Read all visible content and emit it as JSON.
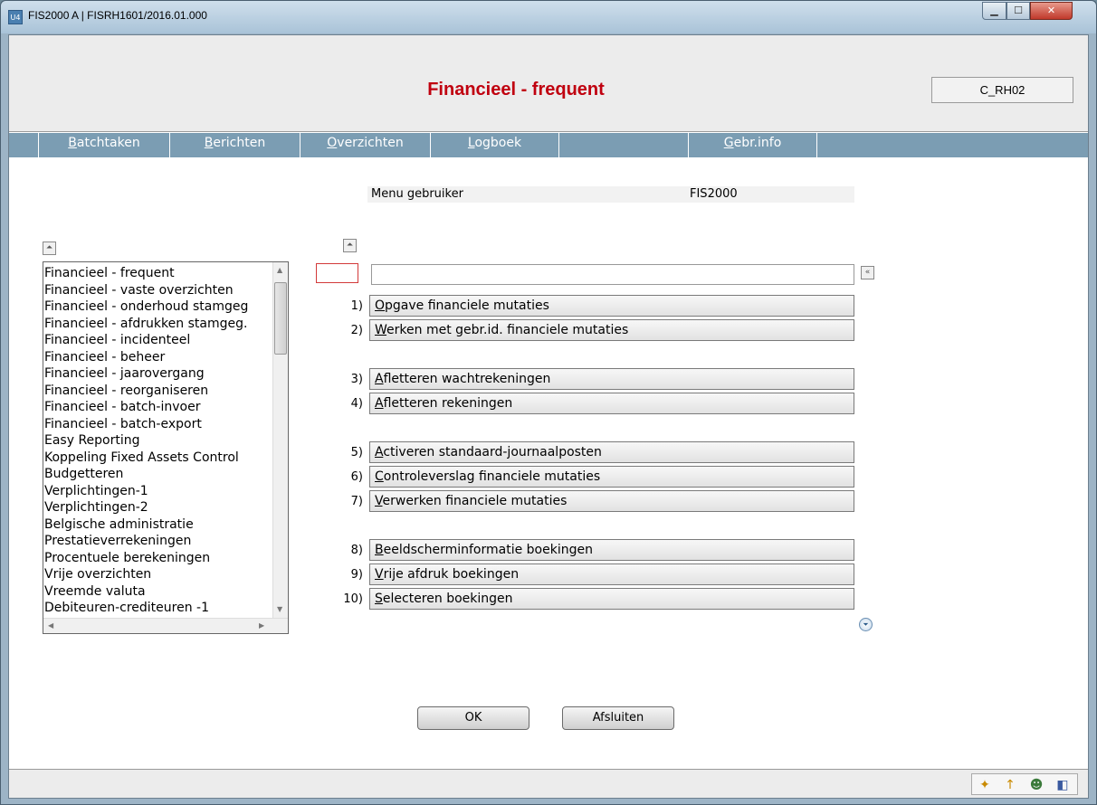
{
  "window": {
    "title": "FIS2000 A | FISRH1601/2016.01.000",
    "app_icon": "U4",
    "controls": {
      "minimize": "▁",
      "maximize": "☐",
      "close": "✕"
    }
  },
  "header": {
    "title": "Financieel - frequent",
    "screen_code": "C_RH02"
  },
  "menubar": {
    "items": [
      {
        "key": "B",
        "rest": "atchtaken"
      },
      {
        "key": "B",
        "rest": "erichten"
      },
      {
        "key": "O",
        "rest": "verzichten"
      },
      {
        "key": "L",
        "rest": "ogboek"
      },
      {
        "key": "",
        "rest": ""
      },
      {
        "key": "G",
        "rest": "ebr.info"
      }
    ]
  },
  "menu_info": {
    "label": "Menu gebruiker",
    "value": "FIS2000"
  },
  "menu_list": {
    "items": [
      "Financieel - frequent",
      "Financieel - vaste overzichten",
      "Financieel - onderhoud stamgeg",
      "Financieel - afdrukken stamgeg.",
      "Financieel - incidenteel",
      "Financieel - beheer",
      "Financieel - jaarovergang",
      "Financieel - reorganiseren",
      "Financieel - batch-invoer",
      "Financieel - batch-export",
      "Easy Reporting",
      "Koppeling Fixed Assets Control",
      "Budgetteren",
      "Verplichtingen-1",
      "Verplichtingen-2",
      "Belgische administratie",
      "Prestatieverrekeningen",
      "Procentuele berekeningen",
      "Vrije overzichten",
      "Vreemde valuta",
      "Debiteuren-crediteuren -1"
    ]
  },
  "options": {
    "option_input": "",
    "search_input": "",
    "items": [
      {
        "num": "1)",
        "key": "O",
        "rest": "pgave financiele mutaties"
      },
      {
        "num": "2)",
        "key": "W",
        "rest": "erken met gebr.id. financiele mutaties"
      },
      {
        "num": "3)",
        "key": "A",
        "rest": "fletteren wachtrekeningen"
      },
      {
        "num": "4)",
        "key": "A",
        "rest": "fletteren rekeningen"
      },
      {
        "num": "5)",
        "key": "A",
        "rest": "ctiveren standaard-journaalposten"
      },
      {
        "num": "6)",
        "key": "C",
        "rest": "ontroleverslag financiele mutaties"
      },
      {
        "num": "7)",
        "key": "V",
        "rest": "erwerken financiele mutaties"
      },
      {
        "num": "8)",
        "key": "B",
        "rest": "eeldscherminformatie boekingen"
      },
      {
        "num": "9)",
        "key": "V",
        "rest": "rije afdruk boekingen"
      },
      {
        "num": "10)",
        "key": "S",
        "rest": "electeren boekingen"
      }
    ]
  },
  "buttons": {
    "ok": "OK",
    "exit": "Afsluiten"
  },
  "icons": {
    "scroll_up": "⏶",
    "scroll_down": "⏷",
    "collapse": "«",
    "tray": [
      "✦",
      "↑",
      "☻",
      "◧"
    ]
  },
  "colors": {
    "title_red": "#c0000f",
    "menubar": "#7b9db3"
  }
}
